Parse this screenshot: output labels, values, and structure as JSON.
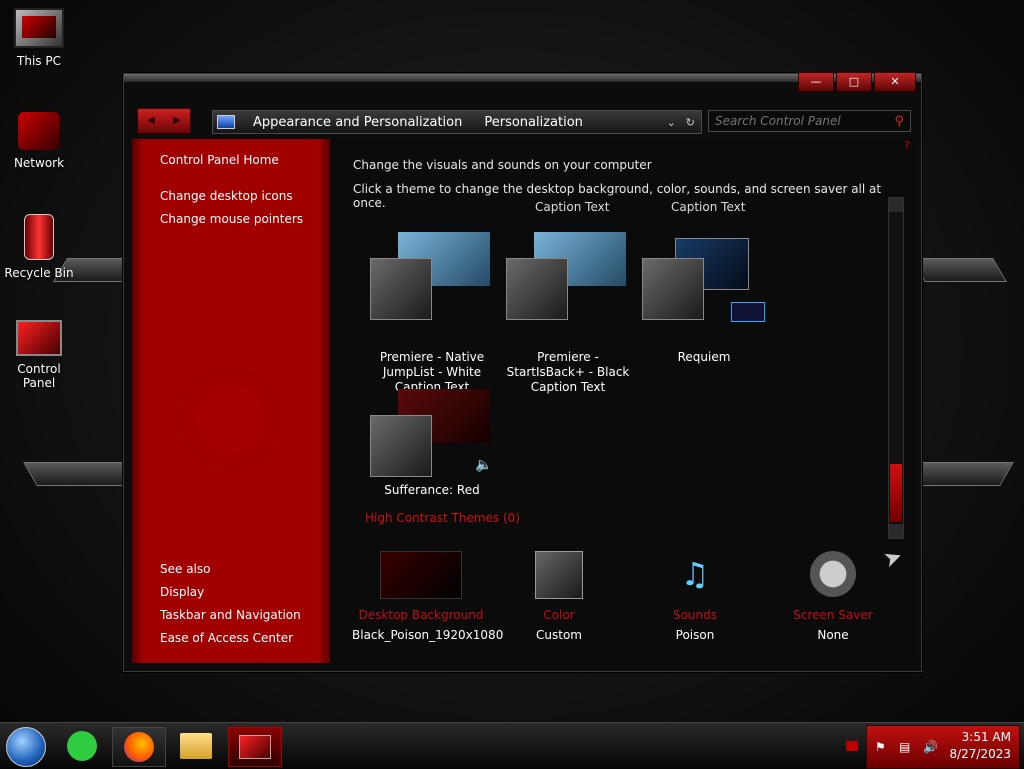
{
  "desktop": {
    "icons": [
      {
        "label": "This PC"
      },
      {
        "label": "Network"
      },
      {
        "label": "Recycle Bin"
      },
      {
        "label": "Control Panel"
      }
    ]
  },
  "window": {
    "breadcrumb": [
      "Appearance and Personalization",
      "Personalization"
    ],
    "search_placeholder": "Search Control Panel",
    "sidebar": {
      "home": "Control Panel Home",
      "links": [
        "Change desktop icons",
        "Change mouse pointers"
      ],
      "see_also_title": "See also",
      "see_also": [
        "Display",
        "Taskbar and Navigation",
        "Ease of Access Center"
      ]
    },
    "main": {
      "heading": "Change the visuals and sounds on your computer",
      "subheading": "Click a theme to change the desktop background, color, sounds, and screen saver all at once.",
      "top_captions": [
        "Caption Text",
        "Caption Text"
      ],
      "themes": [
        {
          "name": "Premiere - Native JumpList - White Caption Text"
        },
        {
          "name": "Premiere - StartIsBack+ - Black Caption Text"
        },
        {
          "name": "Requiem"
        },
        {
          "name": "Sufferance: Red"
        }
      ],
      "high_contrast": "High Contrast Themes (0)",
      "bottom": [
        {
          "title": "Desktop Background",
          "value": "Black_Poison_1920x1080"
        },
        {
          "title": "Color",
          "value": "Custom"
        },
        {
          "title": "Sounds",
          "value": "Poison"
        },
        {
          "title": "Screen Saver",
          "value": "None"
        }
      ]
    }
  },
  "taskbar": {
    "time": "3:51 AM",
    "date": "8/27/2023"
  },
  "colors": {
    "accent": "#a00000",
    "link_red": "#c01010"
  }
}
